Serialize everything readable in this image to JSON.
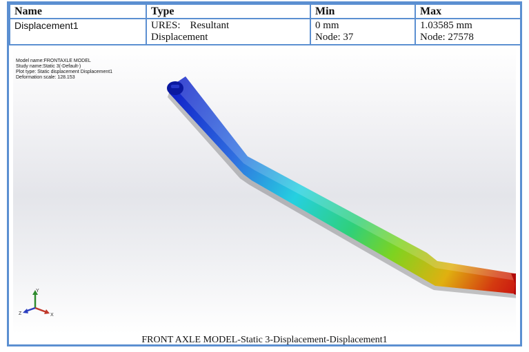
{
  "table": {
    "headers": {
      "name": "Name",
      "type": "Type",
      "min": "Min",
      "max": "Max"
    },
    "row": {
      "name": "Displacement1",
      "type_line1_a": "URES:",
      "type_line1_b": "Resultant",
      "type_line2": "Displacement",
      "min_line1": "0 mm",
      "min_line2": "Node: 37",
      "max_line1": "1.03585 mm",
      "max_line2": "Node: 27578"
    }
  },
  "viewport": {
    "study_info": {
      "model_name": "Model name:FRONTAXLE MODEL",
      "study_name": "Study name:Static 3(-Default-)",
      "plot_type": "Plot type: Static displacement Displacement1",
      "deformation_scale": "Deformation scale: 128.153"
    },
    "triad": {
      "x_label": "X",
      "y_label": "Y",
      "z_label": "Z",
      "x_color": "#c0392b",
      "y_color": "#2e8b2e",
      "z_color": "#2b3fbf"
    },
    "contour_colors": [
      "#1020c8",
      "#2f6ee0",
      "#25d0e0",
      "#2fd07a",
      "#7ed320",
      "#e0b010",
      "#d43a10",
      "#c81010"
    ]
  },
  "caption": "FRONT AXLE MODEL-Static 3-Displacement-Displacement1"
}
